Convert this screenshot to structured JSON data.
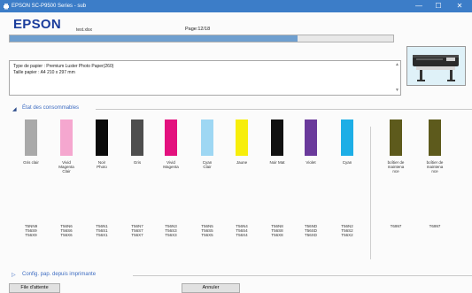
{
  "window": {
    "title": "EPSON SC-P9500 Series - sub",
    "min_glyph": "—",
    "max_glyph": "☐",
    "close_glyph": "✕"
  },
  "header": {
    "logo": "EPSON",
    "document": "test.xlsx",
    "page": "Page:12/18",
    "progress_fraction": 0.75
  },
  "info": {
    "line1": "Type de papier : Premium Luster Photo Paper(260)",
    "line2": "Taille papier : A4 210 x 297 mm"
  },
  "consumables": {
    "title": "État des consommables",
    "inks": [
      {
        "name": [
          "Gris clair"
        ],
        "color": "#a9a9a9",
        "codes": [
          "T5NN9",
          "T56S9",
          "T56X9"
        ]
      },
      {
        "name": [
          "Vivid",
          "Magenta",
          "Clair"
        ],
        "color": "#f5a7cf",
        "codes": [
          "T56N6",
          "T56S6",
          "T56X6"
        ]
      },
      {
        "name": [
          "Noir",
          "Photo"
        ],
        "color": "#0b0b0b",
        "codes": [
          "T56N1",
          "T56S1",
          "T56X1"
        ]
      },
      {
        "name": [
          "Gris"
        ],
        "color": "#4e4e4e",
        "codes": [
          "T56N7",
          "T56S7",
          "T56X7"
        ]
      },
      {
        "name": [
          "Vivid",
          "Magenta"
        ],
        "color": "#e3117e",
        "codes": [
          "T56N3",
          "T56S3",
          "T56X3"
        ]
      },
      {
        "name": [
          "Cyan",
          "Clair"
        ],
        "color": "#9ed7f3",
        "codes": [
          "T56N5",
          "T56S5",
          "T56X5"
        ]
      },
      {
        "name": [
          "Jaune"
        ],
        "color": "#f7ee0b",
        "codes": [
          "T56N4",
          "T56S4",
          "T56X4"
        ]
      },
      {
        "name": [
          "Noir Mat"
        ],
        "color": "#111111",
        "codes": [
          "T56N8",
          "T56S8",
          "T56X8"
        ]
      },
      {
        "name": [
          "Violet"
        ],
        "color": "#6a3a9b",
        "codes": [
          "T56ND",
          "T56SD",
          "T56XD"
        ]
      },
      {
        "name": [
          "Cyan"
        ],
        "color": "#1daee6",
        "codes": [
          "T56N2",
          "T56S2",
          "T56X2"
        ]
      }
    ],
    "maintenance": [
      {
        "name": [
          "boîtier de",
          "maintena",
          "nce"
        ],
        "codes": [
          "T6997"
        ]
      },
      {
        "name": [
          "boîtier de",
          "maintena",
          "nce"
        ],
        "codes": [
          "T6997"
        ]
      }
    ]
  },
  "config": {
    "title": "Config. pap. depuis imprimante"
  },
  "buttons": {
    "queue": "File d'attente",
    "cancel": "Annuler"
  }
}
